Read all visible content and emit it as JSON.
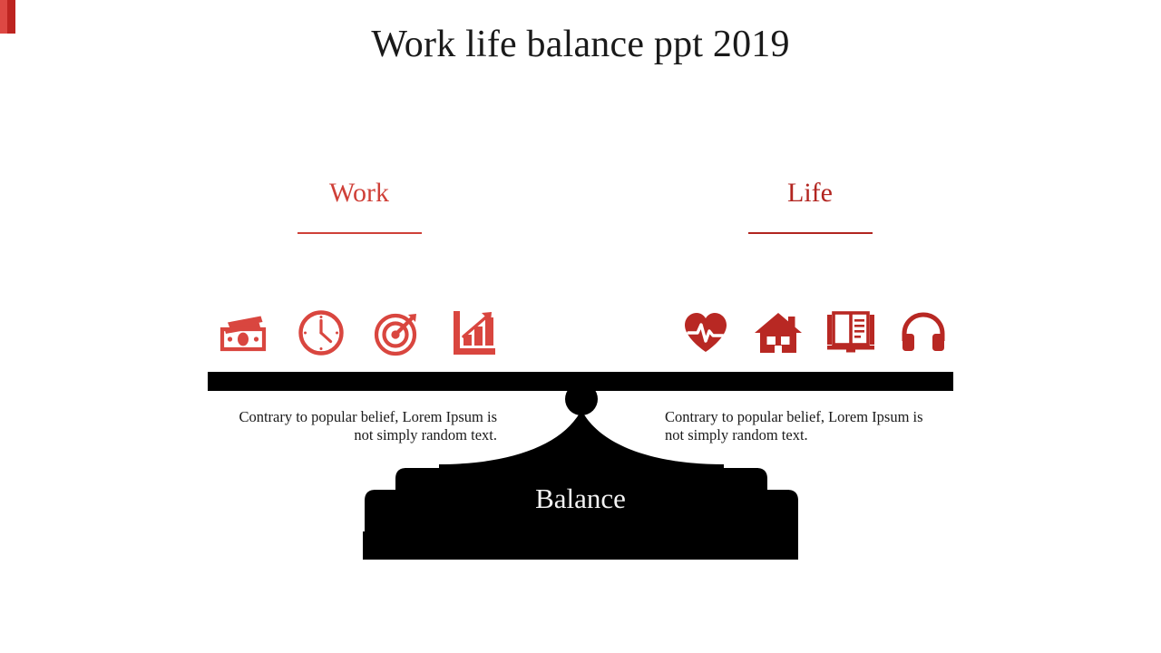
{
  "slide": {
    "title": "Work life balance ppt 2019",
    "accent_color_light": "#dd4843",
    "accent_color_dark": "#bd2420",
    "background_color": "#ffffff",
    "silhouette_color": "#000000"
  },
  "columns": {
    "work": {
      "heading": "Work",
      "heading_color": "#cf4038",
      "description": "Contrary to popular belief, Lorem Ipsum is not simply random text.",
      "icons": [
        {
          "name": "money-icon",
          "label": "Money"
        },
        {
          "name": "clock-icon",
          "label": "Time"
        },
        {
          "name": "target-icon",
          "label": "Goals"
        },
        {
          "name": "growth-chart-icon",
          "label": "Growth"
        }
      ]
    },
    "life": {
      "heading": "Life",
      "heading_color": "#b22520",
      "description": "Contrary to popular belief, Lorem Ipsum is not simply random text.",
      "icons": [
        {
          "name": "heart-pulse-icon",
          "label": "Health"
        },
        {
          "name": "home-icon",
          "label": "Home"
        },
        {
          "name": "open-book-icon",
          "label": "Reading"
        },
        {
          "name": "headphones-icon",
          "label": "Leisure"
        }
      ]
    }
  },
  "scale": {
    "center_label": "Balance",
    "center_label_color": "#f3f3f3"
  }
}
